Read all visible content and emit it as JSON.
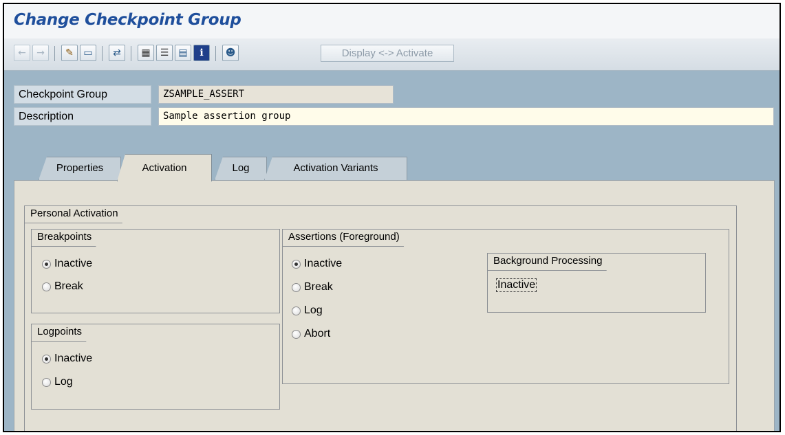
{
  "window": {
    "title": "Change Checkpoint Group"
  },
  "toolbar": {
    "icons": [
      "back-icon",
      "forward-icon",
      "edit-pencil-icon",
      "display-change-icon",
      "other-object-icon",
      "hierarchy-icon",
      "list-icon",
      "screen-icon",
      "info-icon",
      "user-icon"
    ],
    "activate_label": "Display <-> Activate"
  },
  "header": {
    "checkpoint_group_label": "Checkpoint Group",
    "checkpoint_group_value": "ZSAMPLE_ASSERT",
    "description_label": "Description",
    "description_value": "Sample assertion group"
  },
  "tabs": [
    {
      "label": "Properties",
      "active": false
    },
    {
      "label": "Activation",
      "active": true
    },
    {
      "label": "Log",
      "active": false
    },
    {
      "label": "Activation Variants",
      "active": false
    }
  ],
  "personal_activation": {
    "title": "Personal Activation",
    "breakpoints": {
      "title": "Breakpoints",
      "options": [
        "Inactive",
        "Break"
      ],
      "selected": "Inactive"
    },
    "logpoints": {
      "title": "Logpoints",
      "options": [
        "Inactive",
        "Log"
      ],
      "selected": "Inactive"
    },
    "assertions_foreground": {
      "title": "Assertions (Foreground)",
      "options": [
        "Inactive",
        "Break",
        "Log",
        "Abort"
      ],
      "selected": "Inactive"
    },
    "background_processing": {
      "title": "Background Processing",
      "value": "Inactive"
    }
  },
  "colors": {
    "title_text": "#1f4f9c",
    "background": "#9db5c6",
    "panel": "#e3e0d5"
  }
}
